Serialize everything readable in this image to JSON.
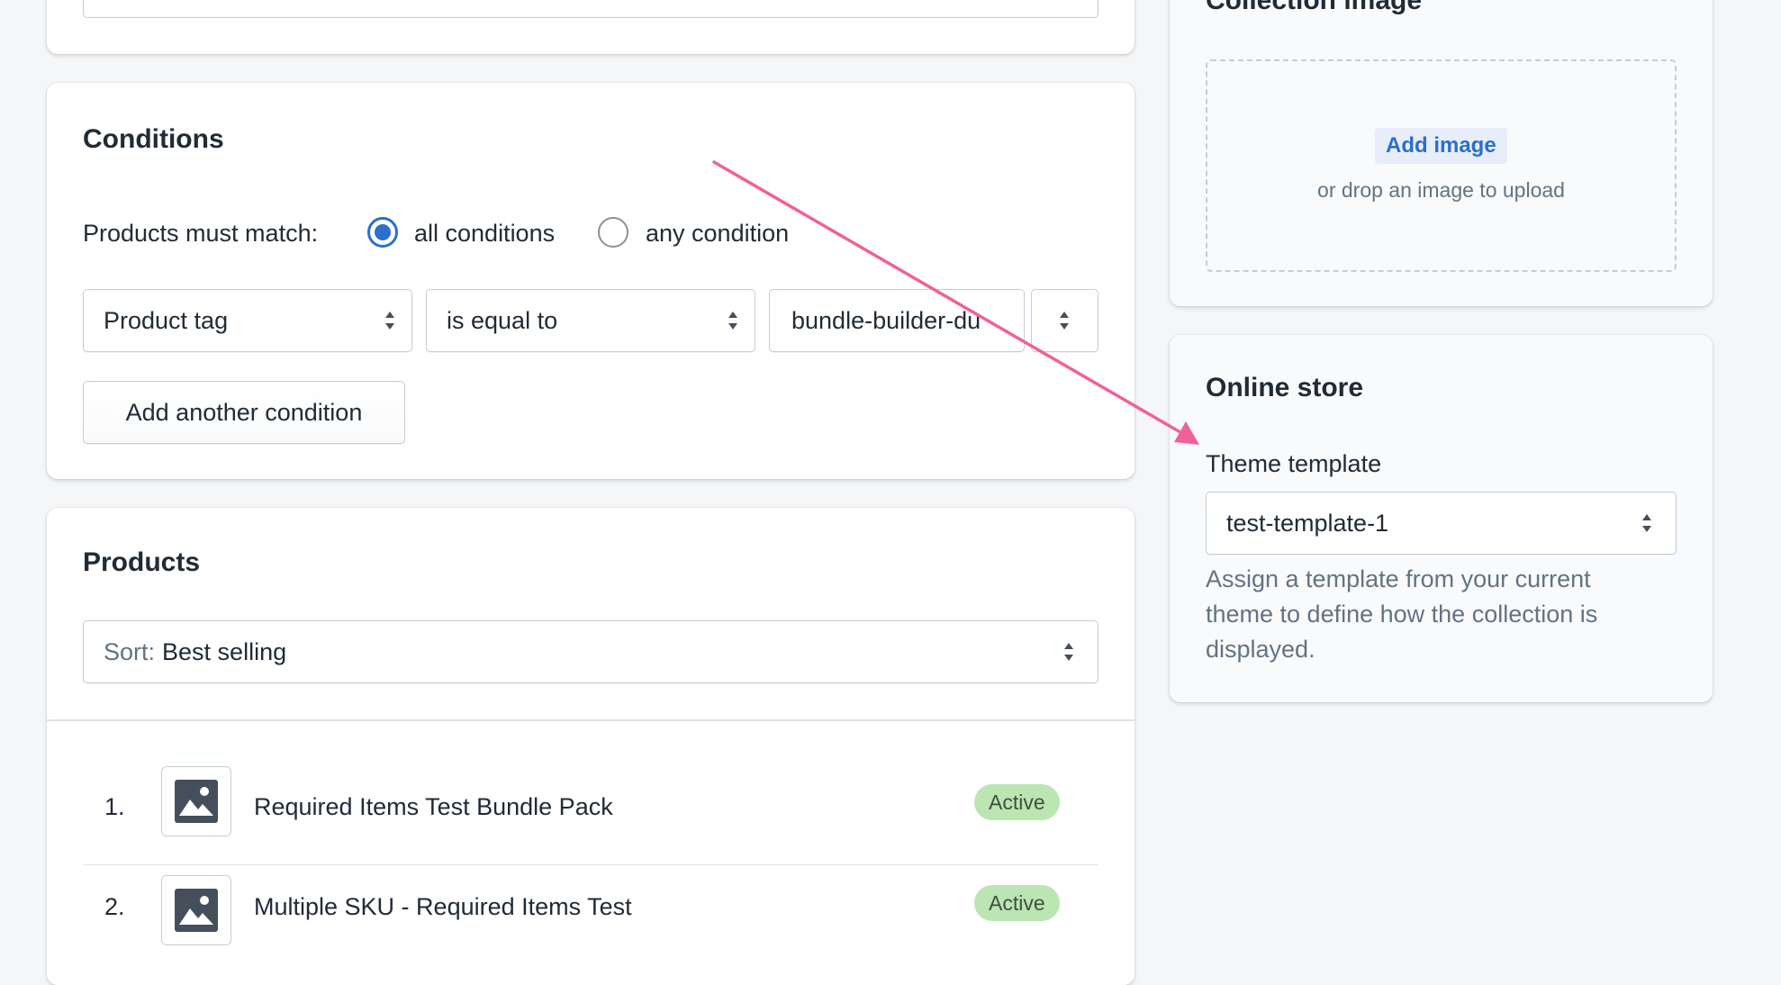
{
  "conditions": {
    "title": "Conditions",
    "match_label": "Products must match:",
    "option_all": "all conditions",
    "option_any": "any condition",
    "selected_option": "all conditions",
    "field_select": "Product tag",
    "operator_select": "is equal to",
    "value_input": "bundle-builder-du",
    "add_button": "Add another condition"
  },
  "products": {
    "title": "Products",
    "sort_prefix": "Sort:",
    "sort_value": "Best selling",
    "items": [
      {
        "index": "1.",
        "name": "Required Items Test Bundle Pack",
        "status": "Active"
      },
      {
        "index": "2.",
        "name": "Multiple SKU - Required Items Test",
        "status": "Active"
      }
    ]
  },
  "collection_image": {
    "title": "Collection image",
    "add_button": "Add image",
    "hint": "or drop an image to upload"
  },
  "online_store": {
    "title": "Online store",
    "template_label": "Theme template",
    "template_value": "test-template-1",
    "help_text": "Assign a template from your current theme to define how the collection is displayed."
  },
  "colors": {
    "radio_selected": "#2c6ecb",
    "badge_bg": "#bbe5b3",
    "arrow": "#f0619a",
    "link": "#2c6ecb"
  }
}
